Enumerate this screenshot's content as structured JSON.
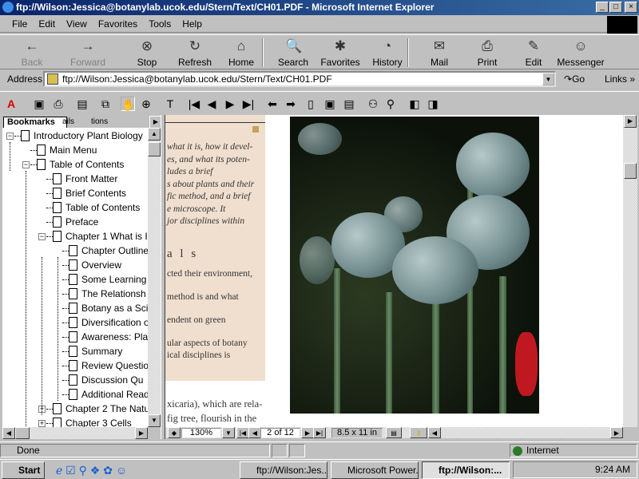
{
  "window": {
    "title": "ftp://Wilson:Jessica@botanylab.ucok.edu/Stern/Text/CH01.PDF - Microsoft Internet Explorer",
    "min": "_",
    "max": "□",
    "close": "×"
  },
  "menu": [
    "File",
    "Edit",
    "View",
    "Favorites",
    "Tools",
    "Help"
  ],
  "toolbar": [
    {
      "label": "Back",
      "icon": "back-arrow-icon",
      "glyph": "←",
      "disabled": true
    },
    {
      "label": "Forward",
      "icon": "forward-arrow-icon",
      "glyph": "→",
      "disabled": true
    },
    {
      "label": "Stop",
      "icon": "stop-icon",
      "glyph": "⊗"
    },
    {
      "label": "Refresh",
      "icon": "refresh-icon",
      "glyph": "↻"
    },
    {
      "label": "Home",
      "icon": "home-icon",
      "glyph": "⌂"
    },
    {
      "label": "Search",
      "icon": "search-icon",
      "glyph": "🔍"
    },
    {
      "label": "Favorites",
      "icon": "favorites-icon",
      "glyph": "✱"
    },
    {
      "label": "History",
      "icon": "history-icon",
      "glyph": "◔"
    },
    {
      "label": "Mail",
      "icon": "mail-icon",
      "glyph": "✉"
    },
    {
      "label": "Print",
      "icon": "print-icon",
      "glyph": "⎙"
    },
    {
      "label": "Edit",
      "icon": "edit-icon",
      "glyph": "✎"
    },
    {
      "label": "Messenger",
      "icon": "messenger-icon",
      "glyph": "☺"
    }
  ],
  "address": {
    "label": "Address",
    "value": "ftp://Wilson:Jessica@botanylab.ucok.edu/Stern/Text/CH01.PDF",
    "go": "Go",
    "links": "Links"
  },
  "bookmarks": {
    "tabs": [
      "Bookmarks",
      "ails",
      "tions"
    ],
    "items": [
      {
        "label": "Introductory Plant Biology",
        "level": 0,
        "toggle": "−"
      },
      {
        "label": "Main Menu",
        "level": 1
      },
      {
        "label": "Table of Contents",
        "level": 1,
        "toggle": "−"
      },
      {
        "label": "Front Matter",
        "level": 2
      },
      {
        "label": "Brief Contents",
        "level": 2
      },
      {
        "label": "Table of Contents",
        "level": 2
      },
      {
        "label": "Preface",
        "level": 2
      },
      {
        "label": "Chapter 1 What is I",
        "level": 2,
        "toggle": "−"
      },
      {
        "label": "Chapter Outline",
        "level": 3
      },
      {
        "label": "Overview",
        "level": 3
      },
      {
        "label": "Some Learning",
        "level": 3
      },
      {
        "label": "The Relationsh",
        "level": 3
      },
      {
        "label": "Botany as a Sci",
        "level": 3
      },
      {
        "label": "Diversification o",
        "level": 3
      },
      {
        "label": "Awareness: Pla",
        "level": 3
      },
      {
        "label": "Summary",
        "level": 3
      },
      {
        "label": "Review Questio",
        "level": 3
      },
      {
        "label": "Discussion Qu",
        "level": 3
      },
      {
        "label": "Additional Read",
        "level": 3
      },
      {
        "label": "Chapter 2 The Natu",
        "level": 2,
        "toggle": "+"
      },
      {
        "label": "Chapter 3 Cells",
        "level": 2,
        "toggle": "+"
      }
    ]
  },
  "page_text": {
    "italic": [
      "what it is, how it devel-",
      "es, and what its poten-",
      "ludes a brief",
      "s about plants and their",
      "fic method, and a brief",
      "e microscope. It",
      "jor disciplines within"
    ],
    "heading": "a l s",
    "lines": [
      "cted their environment,",
      "",
      "method is and what",
      "",
      "endent on green",
      "",
      "ular aspects of botany",
      "ical disciplines is"
    ],
    "bottom": [
      "xicaria), which are rela-",
      "fig tree, flourish in the"
    ]
  },
  "nav": {
    "zoom": "130%",
    "page": "2 of 12",
    "size": "8.5 x 11 in"
  },
  "status": {
    "text": "Done",
    "zone": "Internet"
  },
  "taskbar": {
    "start": "Start",
    "tasks": [
      "ftp://Wilson:Jes...",
      "Microsoft Power...",
      "ftp://Wilson:..."
    ],
    "clock": "9:24 AM"
  },
  "colors": {
    "titlebar": "#0a246a",
    "page_tan": "#f0dfcf",
    "accent_square": "#c8a060"
  }
}
